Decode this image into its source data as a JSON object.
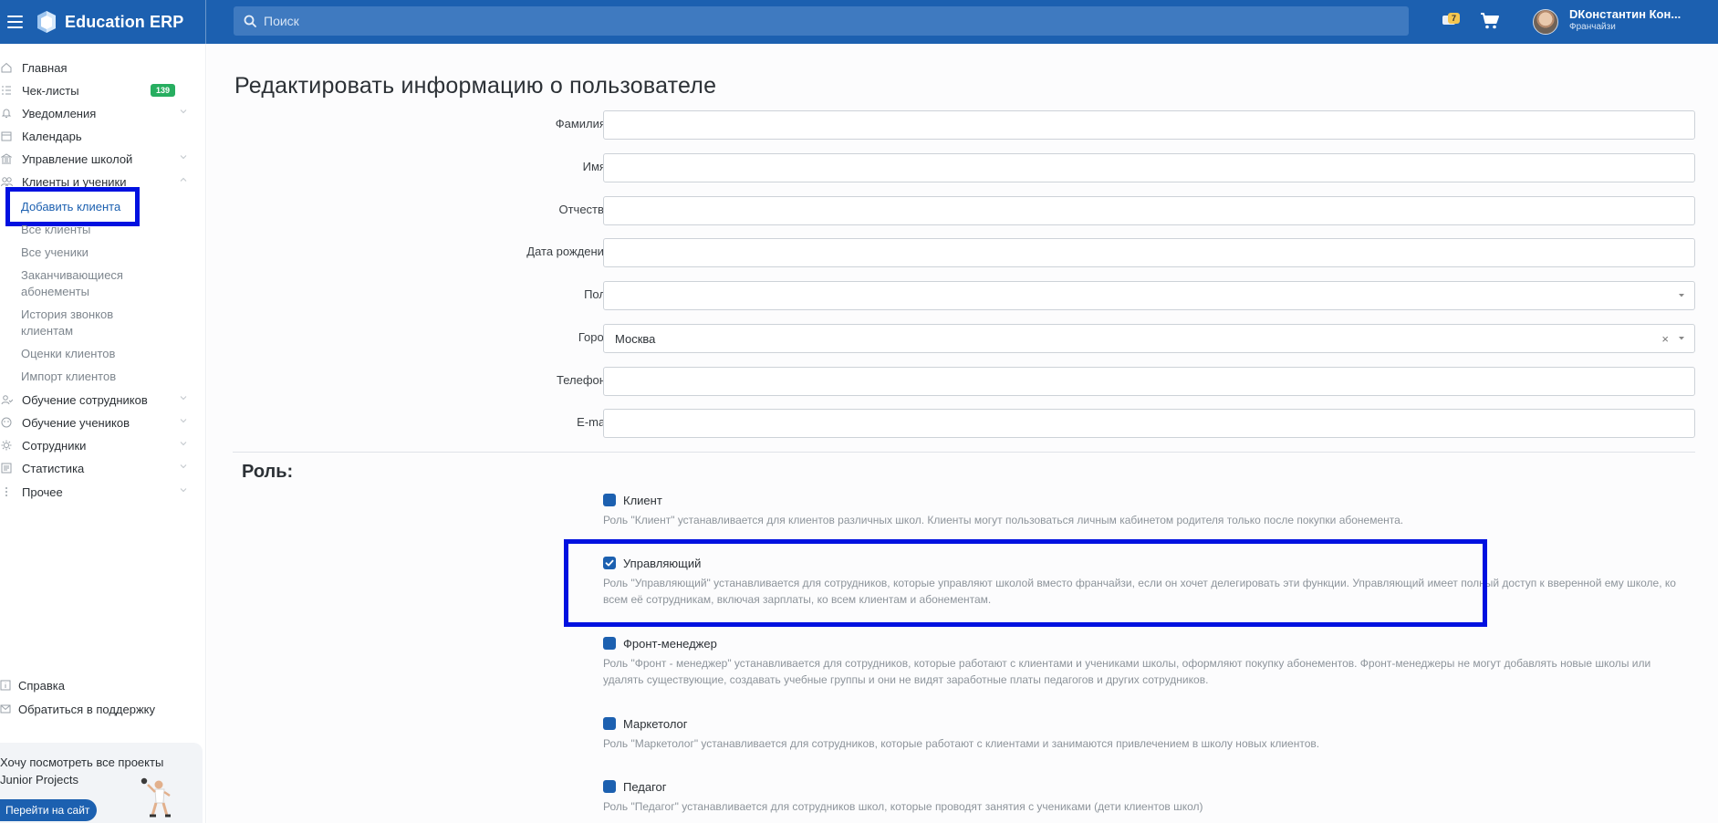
{
  "app": {
    "title": "Education ERP"
  },
  "search": {
    "placeholder": "Поиск"
  },
  "header": {
    "notifications_count": "7",
    "user_name": "DКонстантин Кон...",
    "user_role": "Франчайзи"
  },
  "sidebar": {
    "items": [
      {
        "label": "Главная",
        "icon": "home-icon"
      },
      {
        "label": "Чек-листы",
        "icon": "checklist-icon",
        "badge": "139"
      },
      {
        "label": "Уведомления",
        "icon": "bell-icon"
      },
      {
        "label": "Календарь",
        "icon": "calendar-icon"
      },
      {
        "label": "Управление школой",
        "icon": "school-icon"
      },
      {
        "label": "Клиенты и ученики",
        "icon": "users-icon"
      },
      {
        "label": "Обучение сотрудников",
        "icon": "staff-training-icon"
      },
      {
        "label": "Обучение учеников",
        "icon": "student-training-icon"
      },
      {
        "label": "Сотрудники",
        "icon": "employees-icon"
      },
      {
        "label": "Статистика",
        "icon": "stats-icon"
      },
      {
        "label": "Прочее",
        "icon": "more-icon"
      }
    ],
    "sub_items": [
      "Добавить клиента",
      "Все клиенты",
      "Все ученики",
      "Заканчивающиеся абонементы",
      "История звонков клиентам",
      "Оценки клиентов",
      "Импорт клиентов"
    ],
    "help": "Справка",
    "support": "Обратиться в поддержку",
    "promo_text": "Хочу посмотреть все проекты Junior Projects",
    "promo_button": "Перейти на сайт"
  },
  "page": {
    "title": "Редактировать информацию о пользователе"
  },
  "form": {
    "fields": [
      {
        "label": "Фамилия*",
        "value": ""
      },
      {
        "label": "Имя*",
        "value": ""
      },
      {
        "label": "Отчество",
        "value": ""
      },
      {
        "label": "Дата рождения",
        "value": ""
      },
      {
        "label": "Пол*",
        "value": ""
      },
      {
        "label": "Город",
        "value": "Москва"
      },
      {
        "label": "Телефон*",
        "value": ""
      },
      {
        "label": "E-mail",
        "value": ""
      }
    ]
  },
  "roles": {
    "title": "Роль:",
    "items": [
      {
        "name": "Клиент",
        "checked": false,
        "desc": "Роль \"Клиент\" устанавливается для клиентов различных школ. Клиенты могут пользоваться личным кабинетом родителя только после покупки абонемента."
      },
      {
        "name": "Управляющий",
        "checked": true,
        "desc": "Роль \"Управляющий\" устанавливается для сотрудников, которые управляют школой вместо франчайзи, если он хочет делегировать эти функции. Управляющий имеет полный доступ к вверенной ему школе, ко всем её сотрудникам, включая зарплаты, ко всем клиентам и абонементам."
      },
      {
        "name": "Фронт-менеджер",
        "checked": false,
        "desc": "Роль \"Фронт - менеджер\" устанавливается для сотрудников, которые работают с клиентами и учениками школы, оформляют покупку абонементов. Фронт-менеджеры не могут добавлять новые школы или удалять существующие, создавать учебные группы и они не видят заработные платы педагогов и других сотрудников."
      },
      {
        "name": "Маркетолог",
        "checked": false,
        "desc": "Роль \"Маркетолог\" устанавливается для сотрудников, которые работают с клиентами и занимаются привлечением в школу новых клиентов."
      },
      {
        "name": "Педагог",
        "checked": false,
        "desc": "Роль \"Педагог\" устанавливается для сотрудников школ, которые проводят занятия с учениками (дети клиентов школ)"
      }
    ]
  },
  "colors": {
    "topbar": "#1c60b0",
    "highlight": "#0011e0",
    "badge_green": "#27ae60"
  }
}
